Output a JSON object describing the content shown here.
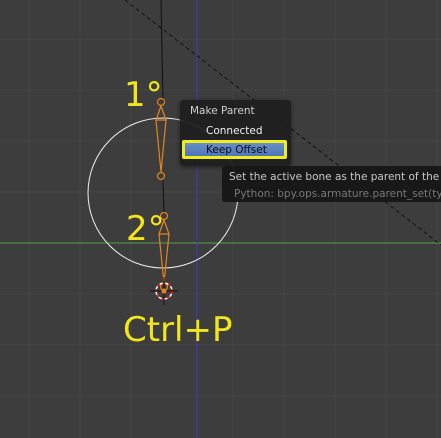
{
  "annotations": {
    "first_label": "1°",
    "second_label": "2°",
    "shortcut_label": "Ctrl+P"
  },
  "context_menu": {
    "title": "Make Parent",
    "items": [
      {
        "label": "Connected"
      },
      {
        "label": "Keep Offset",
        "highlighted": true
      }
    ]
  },
  "tooltip": {
    "description": "Set the active bone as the parent of the sel",
    "python": "Python: bpy.ops.armature.parent_set(type"
  },
  "colors": {
    "background": "#3d3d3d",
    "grid": "#454545",
    "x_axis": "#5b9e4a",
    "z_axis": "#3a3ad0",
    "bone_outline": "#e8841c",
    "annotation": "#f2e61a",
    "highlight_border": "#f0ee18"
  },
  "icons": [
    "bone-icon",
    "3d-cursor-icon"
  ]
}
